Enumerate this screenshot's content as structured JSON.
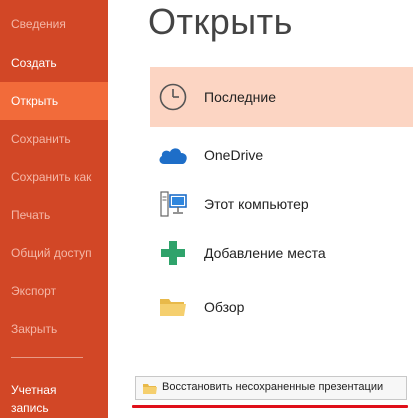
{
  "sidebar": {
    "items": [
      {
        "label": "Сведения"
      },
      {
        "label": "Создать"
      },
      {
        "label": "Открыть"
      },
      {
        "label": "Сохранить"
      },
      {
        "label": "Сохранить как"
      },
      {
        "label": "Печать"
      },
      {
        "label": "Общий доступ"
      },
      {
        "label": "Экспорт"
      },
      {
        "label": "Закрыть"
      }
    ],
    "account_label": "Учетная запись",
    "active_item": "Открыть"
  },
  "main": {
    "title": "Открыть",
    "places": [
      {
        "label": "Последние",
        "icon": "clock-icon",
        "selected": true
      },
      {
        "label": "OneDrive",
        "icon": "cloud-icon"
      },
      {
        "label": "Этот компьютер",
        "icon": "computer-icon"
      },
      {
        "label": "Добавление места",
        "icon": "plus-icon"
      },
      {
        "label": "Обзор",
        "icon": "folder-icon"
      }
    ],
    "recover_button": {
      "label": "Восстановить несохраненные презентации",
      "icon": "folder-icon"
    }
  },
  "colors": {
    "sidebar_bg": "#d24726",
    "sidebar_active": "#f26b3a",
    "selected_place_bg": "#fcd5c3",
    "annotation_red": "#e0101a"
  }
}
